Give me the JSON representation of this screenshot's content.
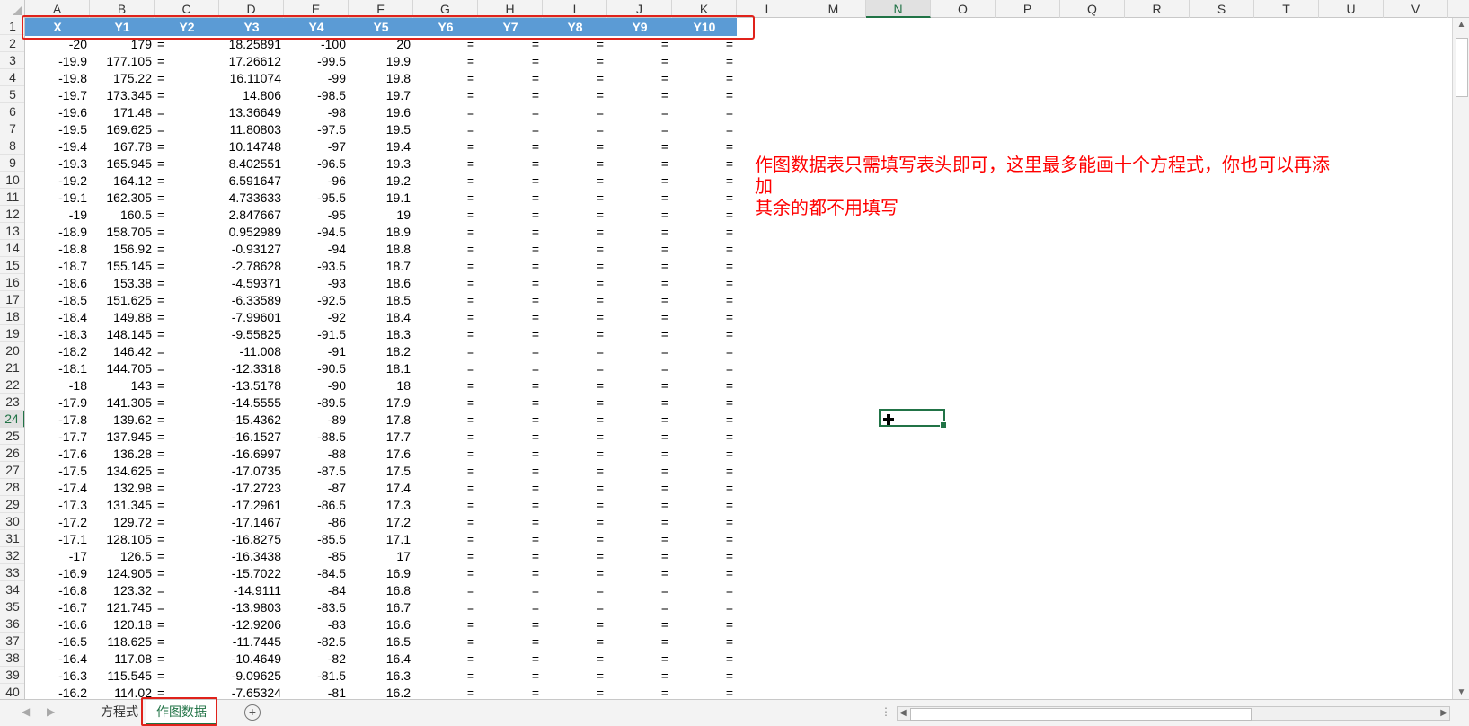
{
  "columns": [
    "A",
    "B",
    "C",
    "D",
    "E",
    "F",
    "G",
    "H",
    "I",
    "J",
    "K",
    "L",
    "M",
    "N",
    "O",
    "P",
    "Q",
    "R",
    "S",
    "T",
    "U",
    "V"
  ],
  "selected_column": "N",
  "selected_row": "24",
  "header_row": [
    "X",
    "Y1",
    "Y2",
    "Y3",
    "Y4",
    "Y5",
    "Y6",
    "Y7",
    "Y8",
    "Y9",
    "Y10"
  ],
  "rows": [
    [
      "-20",
      "179",
      "=",
      "18.25891",
      "-100",
      "20",
      "=",
      "=",
      "=",
      "=",
      "="
    ],
    [
      "-19.9",
      "177.105",
      "=",
      "17.26612",
      "-99.5",
      "19.9",
      "=",
      "=",
      "=",
      "=",
      "="
    ],
    [
      "-19.8",
      "175.22",
      "=",
      "16.11074",
      "-99",
      "19.8",
      "=",
      "=",
      "=",
      "=",
      "="
    ],
    [
      "-19.7",
      "173.345",
      "=",
      "14.806",
      "-98.5",
      "19.7",
      "=",
      "=",
      "=",
      "=",
      "="
    ],
    [
      "-19.6",
      "171.48",
      "=",
      "13.36649",
      "-98",
      "19.6",
      "=",
      "=",
      "=",
      "=",
      "="
    ],
    [
      "-19.5",
      "169.625",
      "=",
      "11.80803",
      "-97.5",
      "19.5",
      "=",
      "=",
      "=",
      "=",
      "="
    ],
    [
      "-19.4",
      "167.78",
      "=",
      "10.14748",
      "-97",
      "19.4",
      "=",
      "=",
      "=",
      "=",
      "="
    ],
    [
      "-19.3",
      "165.945",
      "=",
      "8.402551",
      "-96.5",
      "19.3",
      "=",
      "=",
      "=",
      "=",
      "="
    ],
    [
      "-19.2",
      "164.12",
      "=",
      "6.591647",
      "-96",
      "19.2",
      "=",
      "=",
      "=",
      "=",
      "="
    ],
    [
      "-19.1",
      "162.305",
      "=",
      "4.733633",
      "-95.5",
      "19.1",
      "=",
      "=",
      "=",
      "=",
      "="
    ],
    [
      "-19",
      "160.5",
      "=",
      "2.847667",
      "-95",
      "19",
      "=",
      "=",
      "=",
      "=",
      "="
    ],
    [
      "-18.9",
      "158.705",
      "=",
      "0.952989",
      "-94.5",
      "18.9",
      "=",
      "=",
      "=",
      "=",
      "="
    ],
    [
      "-18.8",
      "156.92",
      "=",
      "-0.93127",
      "-94",
      "18.8",
      "=",
      "=",
      "=",
      "=",
      "="
    ],
    [
      "-18.7",
      "155.145",
      "=",
      "-2.78628",
      "-93.5",
      "18.7",
      "=",
      "=",
      "=",
      "=",
      "="
    ],
    [
      "-18.6",
      "153.38",
      "=",
      "-4.59371",
      "-93",
      "18.6",
      "=",
      "=",
      "=",
      "=",
      "="
    ],
    [
      "-18.5",
      "151.625",
      "=",
      "-6.33589",
      "-92.5",
      "18.5",
      "=",
      "=",
      "=",
      "=",
      "="
    ],
    [
      "-18.4",
      "149.88",
      "=",
      "-7.99601",
      "-92",
      "18.4",
      "=",
      "=",
      "=",
      "=",
      "="
    ],
    [
      "-18.3",
      "148.145",
      "=",
      "-9.55825",
      "-91.5",
      "18.3",
      "=",
      "=",
      "=",
      "=",
      "="
    ],
    [
      "-18.2",
      "146.42",
      "=",
      "-11.008",
      "-91",
      "18.2",
      "=",
      "=",
      "=",
      "=",
      "="
    ],
    [
      "-18.1",
      "144.705",
      "=",
      "-12.3318",
      "-90.5",
      "18.1",
      "=",
      "=",
      "=",
      "=",
      "="
    ],
    [
      "-18",
      "143",
      "=",
      "-13.5178",
      "-90",
      "18",
      "=",
      "=",
      "=",
      "=",
      "="
    ],
    [
      "-17.9",
      "141.305",
      "=",
      "-14.5555",
      "-89.5",
      "17.9",
      "=",
      "=",
      "=",
      "=",
      "="
    ],
    [
      "-17.8",
      "139.62",
      "=",
      "-15.4362",
      "-89",
      "17.8",
      "=",
      "=",
      "=",
      "=",
      "="
    ],
    [
      "-17.7",
      "137.945",
      "=",
      "-16.1527",
      "-88.5",
      "17.7",
      "=",
      "=",
      "=",
      "=",
      "="
    ],
    [
      "-17.6",
      "136.28",
      "=",
      "-16.6997",
      "-88",
      "17.6",
      "=",
      "=",
      "=",
      "=",
      "="
    ],
    [
      "-17.5",
      "134.625",
      "=",
      "-17.0735",
      "-87.5",
      "17.5",
      "=",
      "=",
      "=",
      "=",
      "="
    ],
    [
      "-17.4",
      "132.98",
      "=",
      "-17.2723",
      "-87",
      "17.4",
      "=",
      "=",
      "=",
      "=",
      "="
    ],
    [
      "-17.3",
      "131.345",
      "=",
      "-17.2961",
      "-86.5",
      "17.3",
      "=",
      "=",
      "=",
      "=",
      "="
    ],
    [
      "-17.2",
      "129.72",
      "=",
      "-17.1467",
      "-86",
      "17.2",
      "=",
      "=",
      "=",
      "=",
      "="
    ],
    [
      "-17.1",
      "128.105",
      "=",
      "-16.8275",
      "-85.5",
      "17.1",
      "=",
      "=",
      "=",
      "=",
      "="
    ],
    [
      "-17",
      "126.5",
      "=",
      "-16.3438",
      "-85",
      "17",
      "=",
      "=",
      "=",
      "=",
      "="
    ],
    [
      "-16.9",
      "124.905",
      "=",
      "-15.7022",
      "-84.5",
      "16.9",
      "=",
      "=",
      "=",
      "=",
      "="
    ],
    [
      "-16.8",
      "123.32",
      "=",
      "-14.9111",
      "-84",
      "16.8",
      "=",
      "=",
      "=",
      "=",
      "="
    ],
    [
      "-16.7",
      "121.745",
      "=",
      "-13.9803",
      "-83.5",
      "16.7",
      "=",
      "=",
      "=",
      "=",
      "="
    ],
    [
      "-16.6",
      "120.18",
      "=",
      "-12.9206",
      "-83",
      "16.6",
      "=",
      "=",
      "=",
      "=",
      "="
    ],
    [
      "-16.5",
      "118.625",
      "=",
      "-11.7445",
      "-82.5",
      "16.5",
      "=",
      "=",
      "=",
      "=",
      "="
    ],
    [
      "-16.4",
      "117.08",
      "=",
      "-10.4649",
      "-82",
      "16.4",
      "=",
      "=",
      "=",
      "=",
      "="
    ],
    [
      "-16.3",
      "115.545",
      "=",
      "-9.09625",
      "-81.5",
      "16.3",
      "=",
      "=",
      "=",
      "=",
      "="
    ],
    [
      "-16.2",
      "114.02",
      "=",
      "-7.65324",
      "-81",
      "16.2",
      "=",
      "=",
      "=",
      "=",
      "="
    ]
  ],
  "annotation": {
    "line1": "作图数据表只需填写表头即可，这里最多能画十个方程式，你也可以再添加",
    "line2": "其余的都不用填写"
  },
  "sheet_tabs": [
    {
      "label": "方程式",
      "active": false
    },
    {
      "label": "作图数据",
      "active": true
    }
  ],
  "colors": {
    "header_fill": "#5b9bd5",
    "highlight_outline": "#e0221b",
    "annotation_text": "#ff0000",
    "selection": "#217346"
  }
}
